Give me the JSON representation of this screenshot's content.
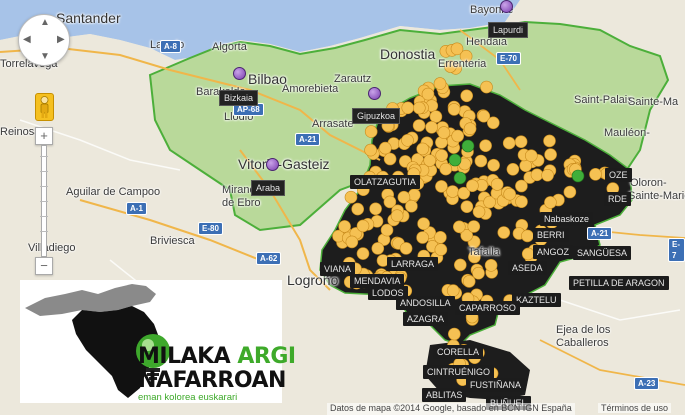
{
  "map": {
    "cities": [
      {
        "name": "Santander",
        "big": true
      },
      {
        "name": "Laredo"
      },
      {
        "name": "Torrelavega"
      },
      {
        "name": "Algorta"
      },
      {
        "name": "Bilbao"
      },
      {
        "name": "Barakaldo"
      },
      {
        "name": "Amorebieta"
      },
      {
        "name": "Zarautz"
      },
      {
        "name": "Donostia",
        "big": true
      },
      {
        "name": "Errenteria"
      },
      {
        "name": "Hendaia"
      },
      {
        "name": "Bayonne"
      },
      {
        "name": "Mauléon-"
      },
      {
        "name": "Saint-Palais"
      },
      {
        "name": "Llodio"
      },
      {
        "name": "Arrasate"
      },
      {
        "name": "Vitoria-Gasteiz",
        "big": true
      },
      {
        "name": "Miranda"
      },
      {
        "name": "de Ebro"
      },
      {
        "name": "Aguilar de Campoo"
      },
      {
        "name": "Reinosa"
      },
      {
        "name": "Briviesca"
      },
      {
        "name": "Villadiego"
      },
      {
        "name": "Logroño",
        "big": true
      },
      {
        "name": "Ejea de los"
      },
      {
        "name": "Caballeros"
      },
      {
        "name": "Sainte-Ma"
      },
      {
        "name": "Tafalla"
      },
      {
        "name": "Oloron-"
      },
      {
        "name": "Sainte-Marie"
      }
    ],
    "roads": [
      "A-8",
      "E-70",
      "AP-68",
      "A-21",
      "A-1",
      "E-80",
      "AP-68",
      "A-62",
      "E-80",
      "A-21",
      "E-7",
      "A-23"
    ],
    "provinces": [
      {
        "name": "Lapurdi"
      },
      {
        "name": "Bizkaia"
      },
      {
        "name": "Gipuzkoa"
      },
      {
        "name": "Araba"
      }
    ],
    "place_tags": [
      "OLATZAGUTIA",
      "OZE",
      "RDE",
      "Nabaskoze",
      "BERRI",
      "SANGÜESA",
      "PETILLA DE ARAGON",
      "ASEDA",
      "KAZTELU",
      "ANGOZ",
      "AZAGRA",
      "LODOS",
      "ANDOSILLA",
      "CAPARROSO",
      "ABLITAS",
      "CINTRUÉNIGO",
      "MENDAVIA",
      "VIANA",
      "LARRAGA",
      "BUÑUEL",
      "CORELLA",
      "FUSTIÑANA"
    ],
    "colors": {
      "navarra_fill": "#2a2a2a",
      "region_fill": "#b9d99a",
      "border": "#4caf3a",
      "marker_yellow": "#f5c153",
      "marker_green": "#3fae3a",
      "sea": "#a7c3e8",
      "land": "#ece8dc"
    }
  },
  "controls": {
    "pan_icon": "pan-compass-icon",
    "pegman_icon": "street-view-pegman-icon",
    "zoom_in": "+",
    "zoom_out": "−"
  },
  "logo": {
    "word1": "MILAKA",
    "word2": "ARGI",
    "word3": "NAFARROAN",
    "tagline": "eman kolorea euskarari"
  },
  "attribution": "Datos de mapa ©2014 Google, basado en BCN IGN España",
  "terms": "Términos de uso"
}
